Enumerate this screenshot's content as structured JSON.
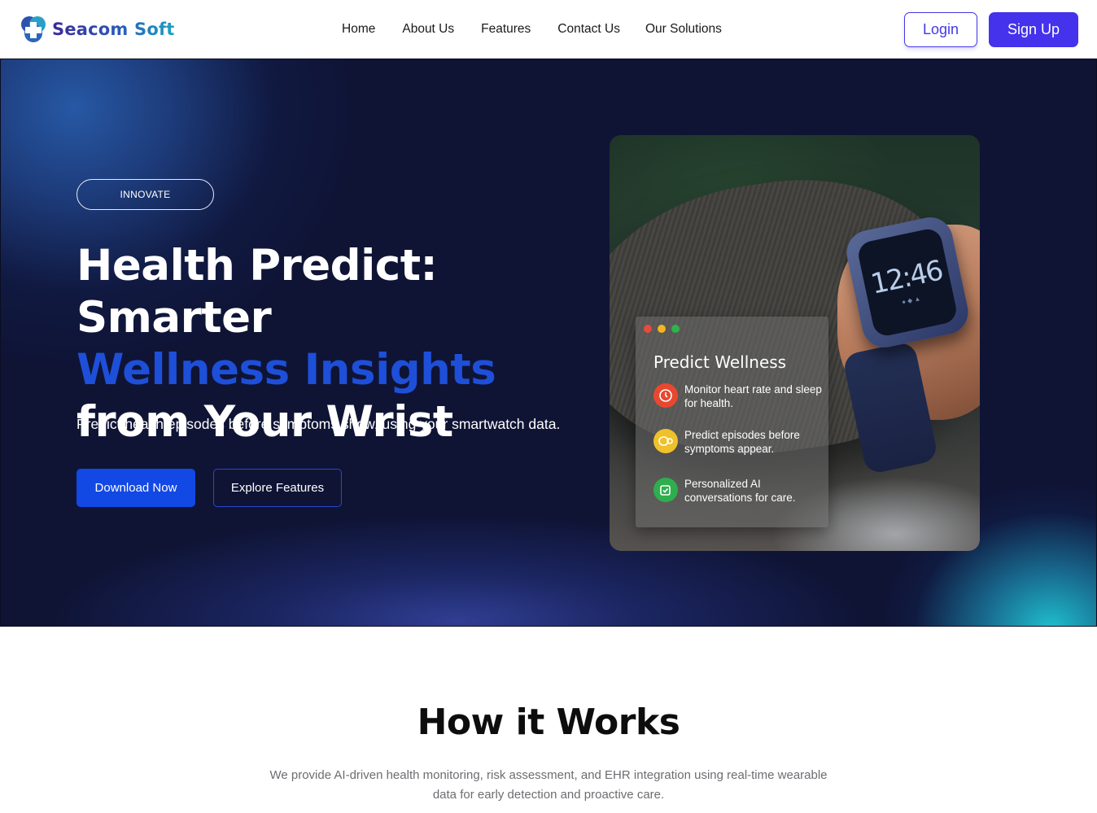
{
  "brand": {
    "name": "Seacom Soft",
    "logo_icon": "medical-cross-logo-icon"
  },
  "nav": {
    "links": [
      "Home",
      "About Us",
      "Features",
      "Contact Us",
      "Our Solutions"
    ],
    "login_label": "Login",
    "signup_label": "Sign Up"
  },
  "hero": {
    "pill_label": "INNOVATE",
    "headline_part1": "Health Predict: Smarter",
    "headline_accent": "Wellness Insights",
    "headline_part2": " from Your Wrist",
    "subtext": "Predict health episodes before symptoms show, using your smartwatch data.",
    "download_label": "Download Now",
    "explore_label": "Explore Features",
    "watch_time": "12:46"
  },
  "card": {
    "title": "Predict Wellness",
    "features": [
      {
        "icon": "heart-rate-icon",
        "color": "#e8482f",
        "text": "Monitor heart rate and sleep for health."
      },
      {
        "icon": "prediction-icon",
        "color": "#efc12a",
        "text": "Predict episodes before symptoms appear."
      },
      {
        "icon": "ai-chat-icon",
        "color": "#2fae4e",
        "text": "Personalized AI conversations for care."
      }
    ],
    "window_dot_colors": [
      "#e84a3a",
      "#f2b61f",
      "#2eb54a"
    ]
  },
  "how": {
    "title": "How it Works",
    "description": "We provide AI-driven health monitoring, risk assessment, and EHR integration using real-time wearable data for early detection and proactive care."
  },
  "colors": {
    "accent": "#4432ec",
    "primary_button": "#1248e3",
    "hero_background": "#0f1435",
    "headline_accent": "#1e4fd9"
  }
}
